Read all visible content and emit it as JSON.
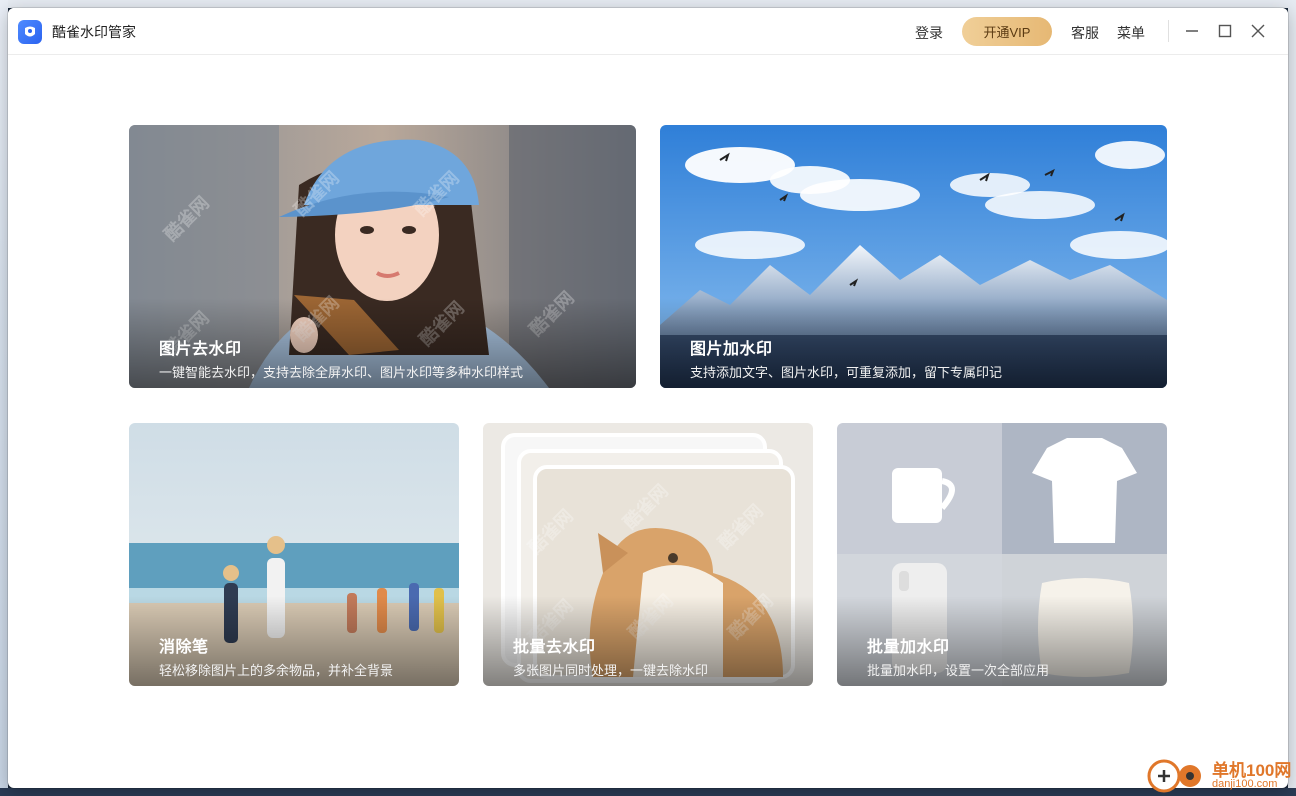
{
  "app": {
    "title": "酷雀水印管家",
    "icon": "app-logo-icon",
    "accent": "#2b63f0"
  },
  "titlebar": {
    "login": "登录",
    "vip": "开通VIP",
    "service": "客服",
    "menu": "菜单",
    "vip_color": "#e6b874"
  },
  "features": [
    {
      "title": "图片去水印",
      "desc": "一键智能去水印，支持去除全屏水印、图片水印等多种水印样式"
    },
    {
      "title": "图片加水印",
      "desc": "支持添加文字、图片水印，可重复添加，留下专属印记"
    },
    {
      "title": "消除笔",
      "desc": "轻松移除图片上的多余物品，并补全背景"
    },
    {
      "title": "批量去水印",
      "desc": "多张图片同时处理，一键去除水印"
    },
    {
      "title": "批量加水印",
      "desc": "批量加水印，设置一次全部应用"
    }
  ],
  "watermark_text": "酷雀网",
  "badge": {
    "name": "单机100网",
    "url": "danji100.com"
  }
}
